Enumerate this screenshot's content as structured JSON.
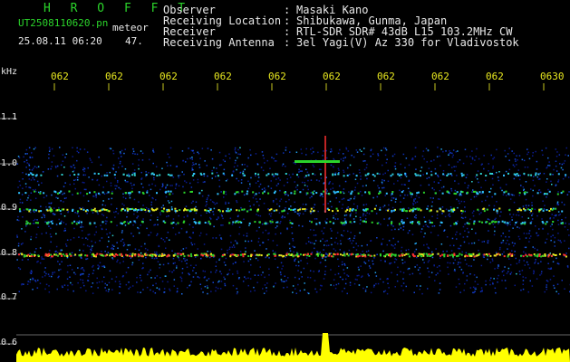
{
  "header": {
    "station": "H R O F F T",
    "filename": "UT2508110620.pn",
    "mode": "meteor",
    "datetime": "25.08.11 06:20",
    "count": "47.",
    "info": [
      {
        "label": "Observer",
        "value": "Masaki Kano"
      },
      {
        "label": "Receiving Location",
        "value": "Shibukawa, Gunma, Japan"
      },
      {
        "label": "Receiver",
        "value": "RTL-SDR SDR# 43dB L15 103.2MHz CW"
      },
      {
        "label": "Receiving Antenna",
        "value": "3el Yagi(V) Az 330 for Vladivostok"
      }
    ],
    "colon": ":"
  },
  "axis": {
    "unit": "kHz",
    "y_ticks": [
      "1.1",
      "1.0",
      "0.9",
      "0.8",
      "0.7",
      "0.6"
    ],
    "x_ticks": [
      "062",
      "062",
      "062",
      "062",
      "062",
      "062",
      "062",
      "062",
      "062",
      "0630"
    ]
  },
  "colors": {
    "background": "#000000",
    "text_green": "#2bd42b",
    "text_white": "#e8e8e8",
    "text_yellow": "#e8e820",
    "signal": "#ff3030",
    "amplitude": "#ffff00"
  }
}
